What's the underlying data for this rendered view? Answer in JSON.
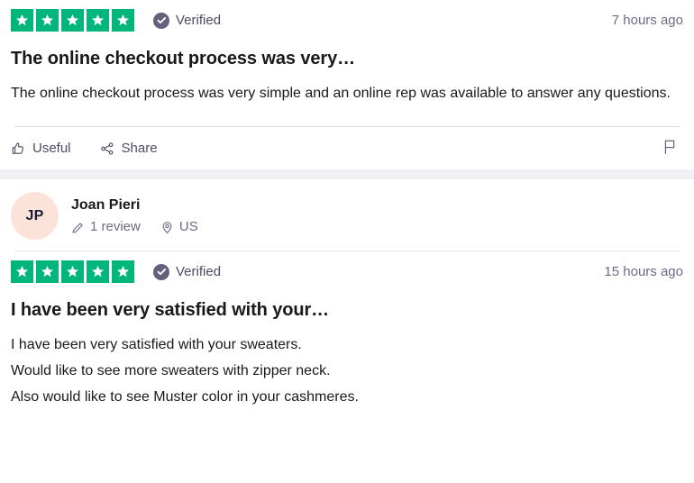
{
  "theme": {
    "star_green": "#00b67a",
    "verified_badge": "#62627e",
    "avatar_bg": "#fbe3d9",
    "text_primary": "#191919",
    "text_muted": "#6b6b83",
    "separator": "#f1f0f5",
    "rule": "#dcdce6"
  },
  "reviews": [
    {
      "rating": 5,
      "rating_label": "5 out of 5 stars",
      "verified_label": "Verified",
      "timestamp": "7 hours ago",
      "title": "The online checkout process was very…",
      "body_lines": [
        "The online checkout process was very simple and an online rep was available to answer any questions."
      ],
      "actions": {
        "useful_label": "Useful",
        "share_label": "Share",
        "report_icon": "flag-icon"
      }
    },
    {
      "author": {
        "initials": "JP",
        "name": "Joan Pieri",
        "review_count": "1 review",
        "location": "US"
      },
      "rating": 5,
      "rating_label": "5 out of 5 stars",
      "verified_label": "Verified",
      "timestamp": "15 hours ago",
      "title": "I have been very satisfied with your…",
      "body_lines": [
        "I have been very satisfied with your sweaters.",
        "Would like to see more sweaters with zipper neck.",
        "Also would like to see Muster color in your cashmeres."
      ]
    }
  ]
}
